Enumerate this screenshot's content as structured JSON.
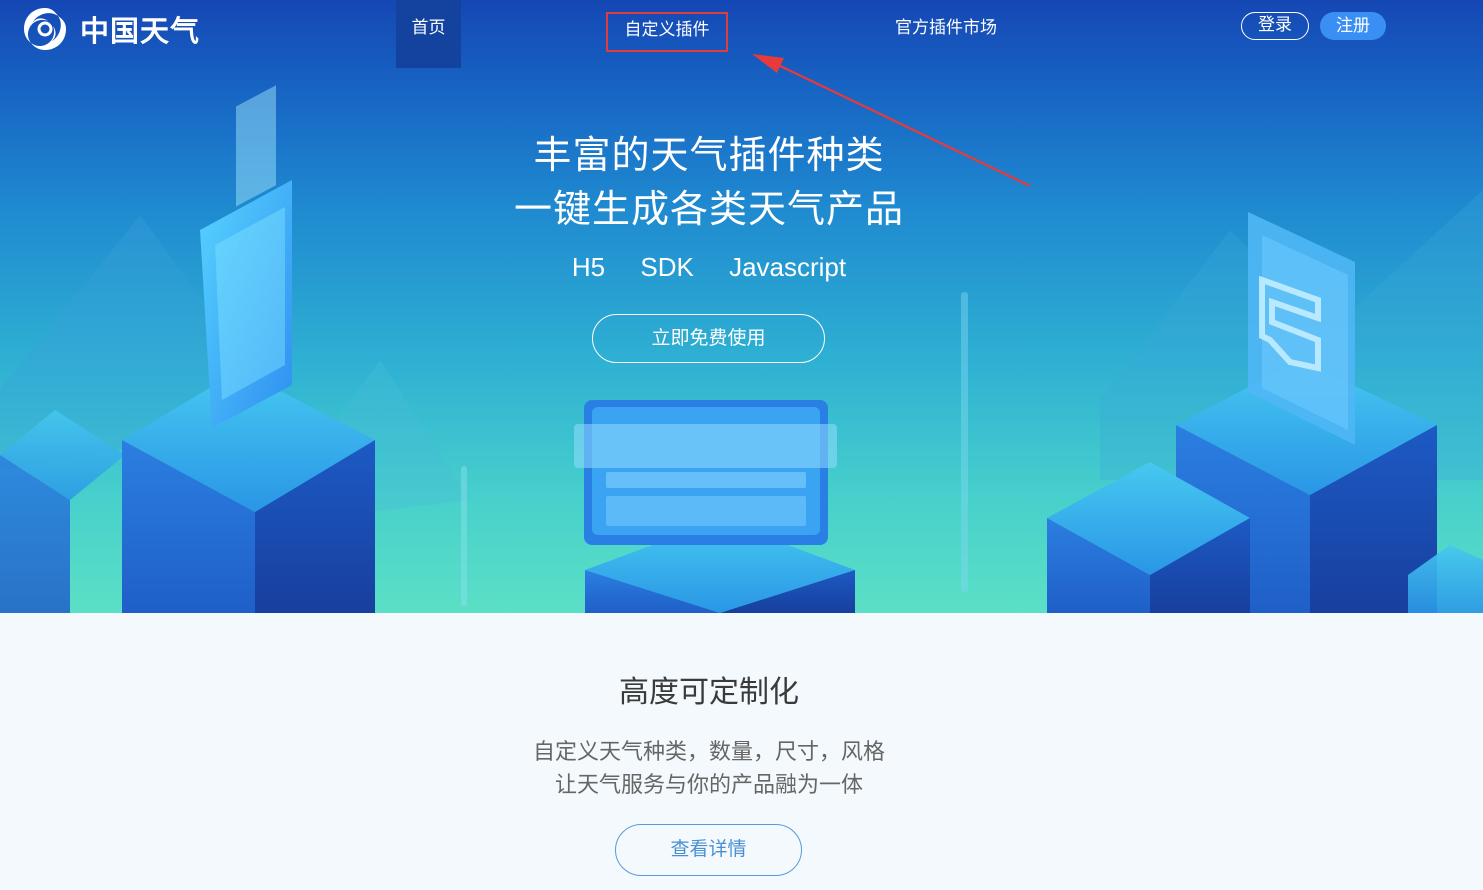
{
  "brand": {
    "name": "中国天气",
    "logo_icon": "swirl-logo-icon"
  },
  "nav": {
    "items": [
      {
        "label": "首页",
        "active": true
      },
      {
        "label": "自定义插件",
        "highlighted": true
      },
      {
        "label": "官方插件市场"
      }
    ],
    "login_label": "登录",
    "register_label": "注册"
  },
  "hero": {
    "title_line1": "丰富的天气插件种类",
    "title_line2": "一键生成各类天气产品",
    "platforms": [
      "H5",
      "SDK",
      "Javascript"
    ],
    "cta_label": "立即免费使用"
  },
  "feature": {
    "title": "高度可定制化",
    "desc_line1": "自定义天气种类，数量，尺寸，风格",
    "desc_line2": "让天气服务与你的产品融为一体",
    "button_label": "查看详情"
  },
  "colors": {
    "nav_active_bg": "#13429f",
    "highlight_box": "#e33b3b",
    "register_bg": "#3a8ff5",
    "detail_button": "#4a8fd4"
  }
}
